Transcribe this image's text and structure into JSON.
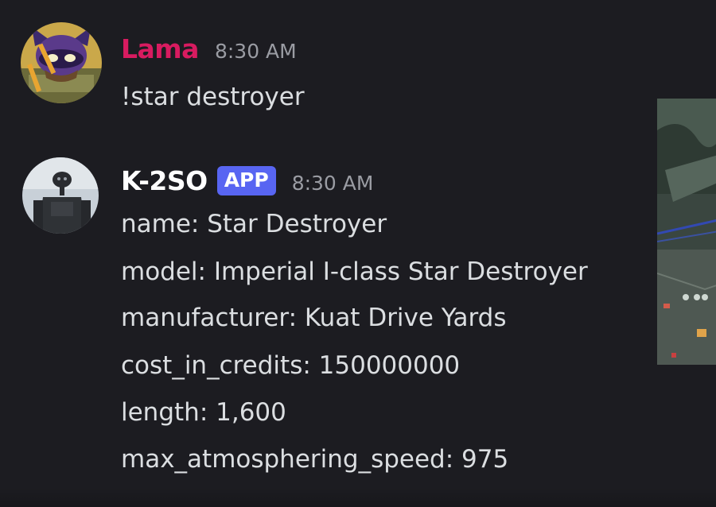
{
  "messages": [
    {
      "author": "Lama",
      "author_color": "#d81b60",
      "timestamp": "8:30 AM",
      "lines": [
        "!star destroyer"
      ]
    },
    {
      "author": "K-2SO",
      "author_color": "#ffffff",
      "badge": "APP",
      "badge_color": "#5865f2",
      "timestamp": "8:30 AM",
      "lines": [
        "name: Star Destroyer",
        "model: Imperial I-class Star Destroyer",
        "manufacturer: Kuat Drive Yards",
        "cost_in_credits: 150000000",
        "length: 1,600",
        "max_atmosphering_speed: 975"
      ]
    }
  ],
  "colors": {
    "background": "#1c1c21",
    "text": "#dbdee1",
    "timestamp": "#9a9ca3"
  },
  "icons": {
    "lama_avatar": "cartoon-ninja-turtle-avatar",
    "k2so_avatar": "droid-robot-avatar",
    "embed_image": "map-image-thumbnail"
  }
}
